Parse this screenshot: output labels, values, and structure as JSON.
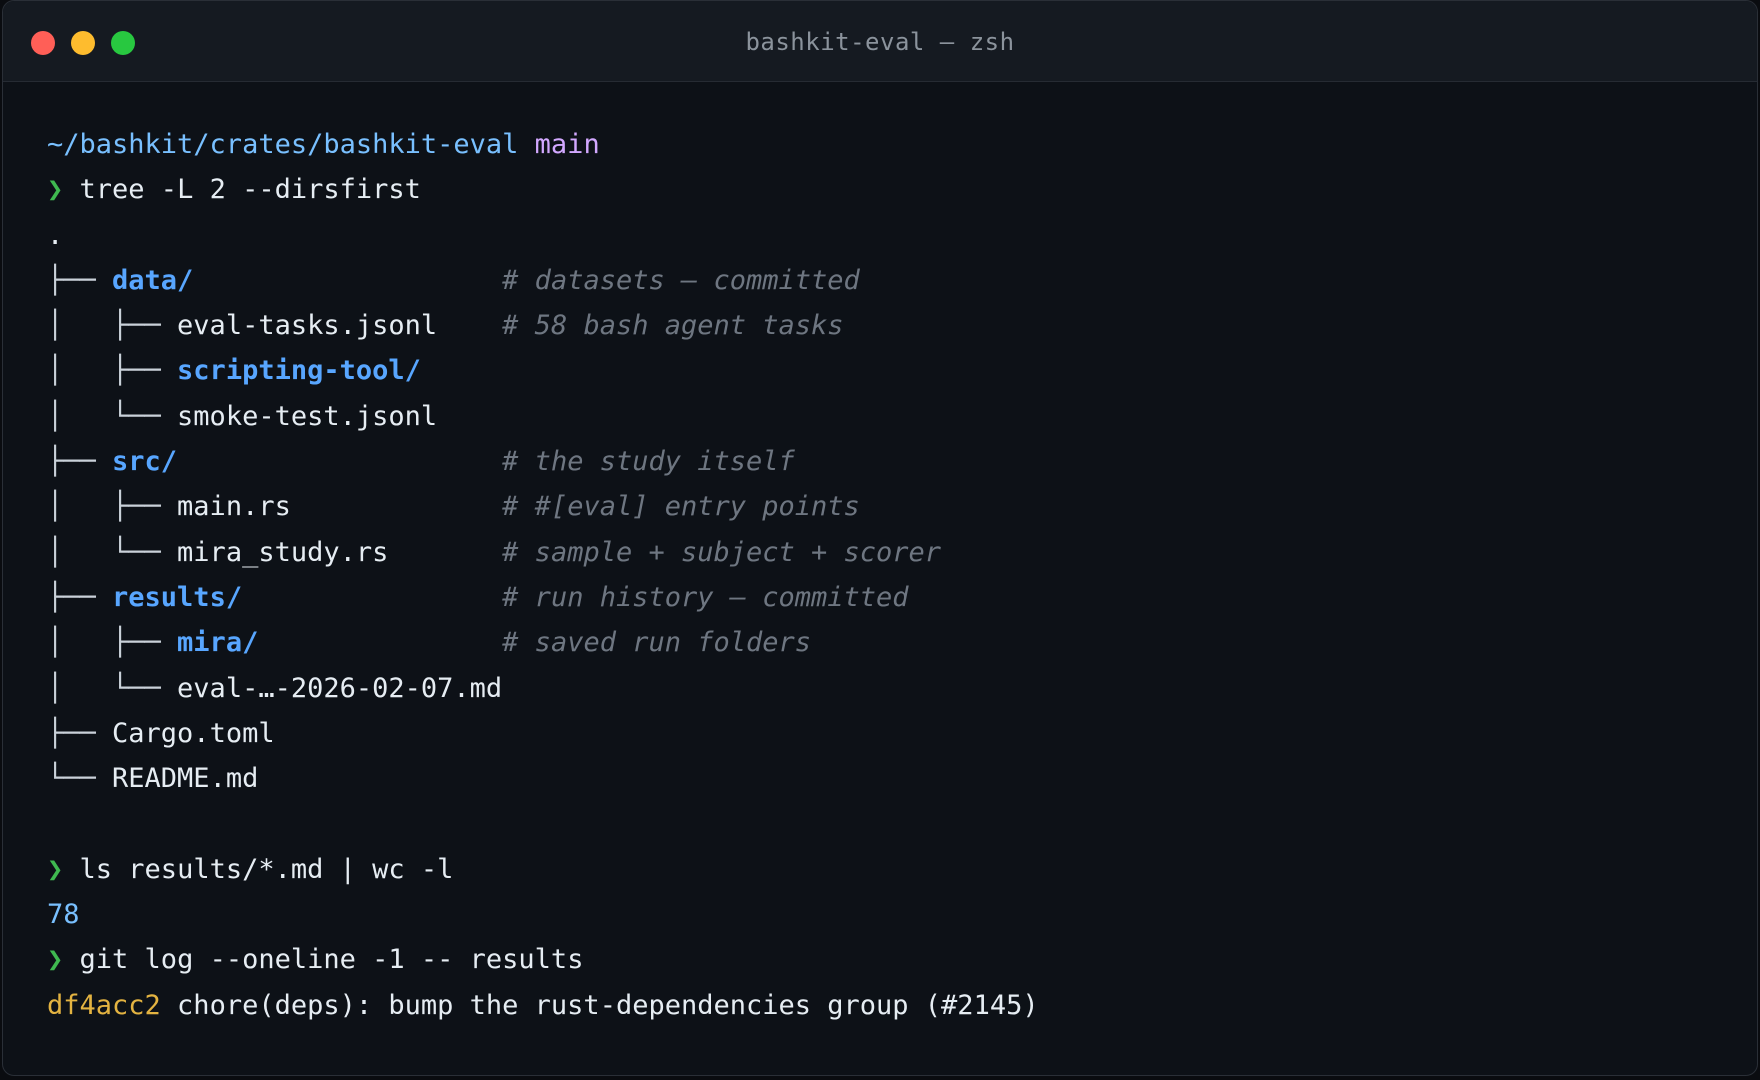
{
  "window": {
    "title": "bashkit-eval — zsh"
  },
  "terminal": {
    "prompt_symbol": "❯",
    "cwd": "~/bashkit/crates/bashkit-eval",
    "branch": "main",
    "cmd_tree": "tree -L 2 --dirsfirst",
    "tree_root": ".",
    "tree": [
      {
        "prefix": "├── ",
        "name": "data/",
        "is_dir": true,
        "comment": "# datasets — committed"
      },
      {
        "prefix": "│   ├── ",
        "name": "eval-tasks.jsonl",
        "is_dir": false,
        "comment": "# 58 bash agent tasks"
      },
      {
        "prefix": "│   ├── ",
        "name": "scripting-tool/",
        "is_dir": true,
        "comment": ""
      },
      {
        "prefix": "│   └── ",
        "name": "smoke-test.jsonl",
        "is_dir": false,
        "comment": ""
      },
      {
        "prefix": "├── ",
        "name": "src/",
        "is_dir": true,
        "comment": "# the study itself"
      },
      {
        "prefix": "│   ├── ",
        "name": "main.rs",
        "is_dir": false,
        "comment": "# #[eval] entry points"
      },
      {
        "prefix": "│   └── ",
        "name": "mira_study.rs",
        "is_dir": false,
        "comment": "# sample + subject + scorer"
      },
      {
        "prefix": "├── ",
        "name": "results/",
        "is_dir": true,
        "comment": "# run history — committed"
      },
      {
        "prefix": "│   ├── ",
        "name": "mira/",
        "is_dir": true,
        "comment": "# saved run folders"
      },
      {
        "prefix": "│   └── ",
        "name": "eval-…-2026-02-07.md",
        "is_dir": false,
        "comment": ""
      },
      {
        "prefix": "├── ",
        "name": "Cargo.toml",
        "is_dir": false,
        "comment": ""
      },
      {
        "prefix": "└── ",
        "name": "README.md",
        "is_dir": false,
        "comment": ""
      }
    ],
    "cmd_ls": "ls results/*.md | wc -l",
    "ls_output": "78",
    "cmd_git": "git log --oneline -1 -- results",
    "git_hash": "df4acc2",
    "git_message": " chore(deps): bump the rust-dependencies group (#2145)"
  }
}
